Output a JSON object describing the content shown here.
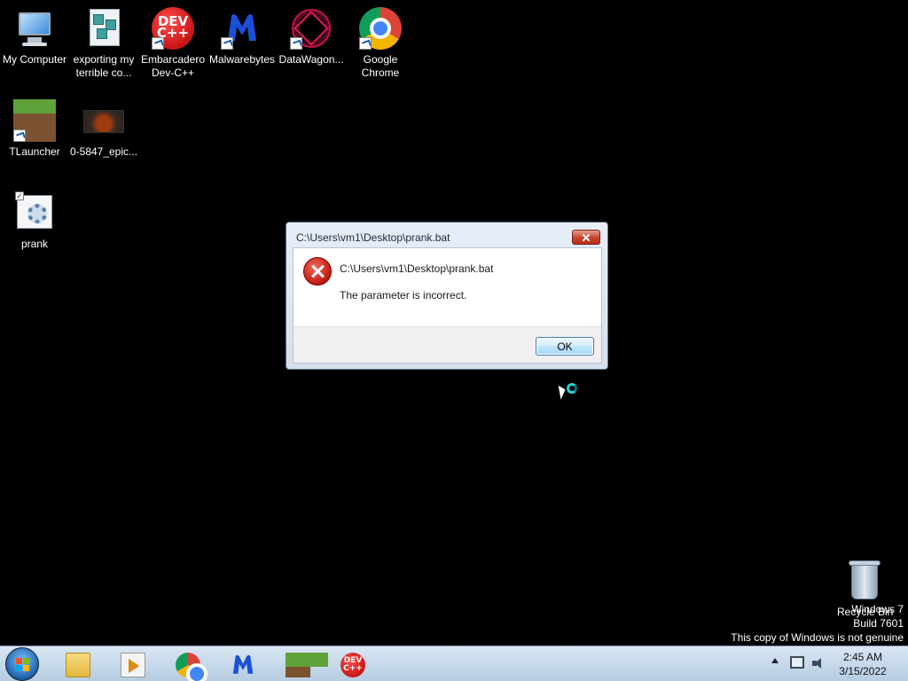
{
  "desktop": {
    "icons": [
      {
        "label": "My Computer"
      },
      {
        "label": "exporting my\nterrible co..."
      },
      {
        "label": "Embarcadero\nDev-C++"
      },
      {
        "label": "Malwarebytes"
      },
      {
        "label": "DataWagon..."
      },
      {
        "label": "Google\nChrome"
      },
      {
        "label": "TLauncher"
      },
      {
        "label": "0-5847_epic..."
      },
      {
        "label": "prank"
      }
    ],
    "dev_logo_text": "DEV\nC++"
  },
  "dialog": {
    "title": "C:\\Users\\vm1\\Desktop\\prank.bat",
    "path": "C:\\Users\\vm1\\Desktop\\prank.bat",
    "message": "The parameter is incorrect.",
    "ok_label": "OK",
    "icon": "error-icon"
  },
  "recycle_bin": {
    "label": "Recycle Bin"
  },
  "watermark": {
    "line1": "Windows 7",
    "line2": "Build 7601",
    "line3": "This copy of Windows is not genuine"
  },
  "taskbar": {
    "pinned": [
      "windows-explorer",
      "windows-media-player",
      "google-chrome",
      "malwarebytes",
      "tlauncher",
      "dev-cpp"
    ],
    "clock_time": "2:45 AM",
    "clock_date": "3/15/2022"
  },
  "colors": {
    "desktop_bg": "#000000",
    "taskbar": "#b6cce2",
    "dialog_close": "#c7432c",
    "ok_button_border": "#3c7fb1"
  }
}
